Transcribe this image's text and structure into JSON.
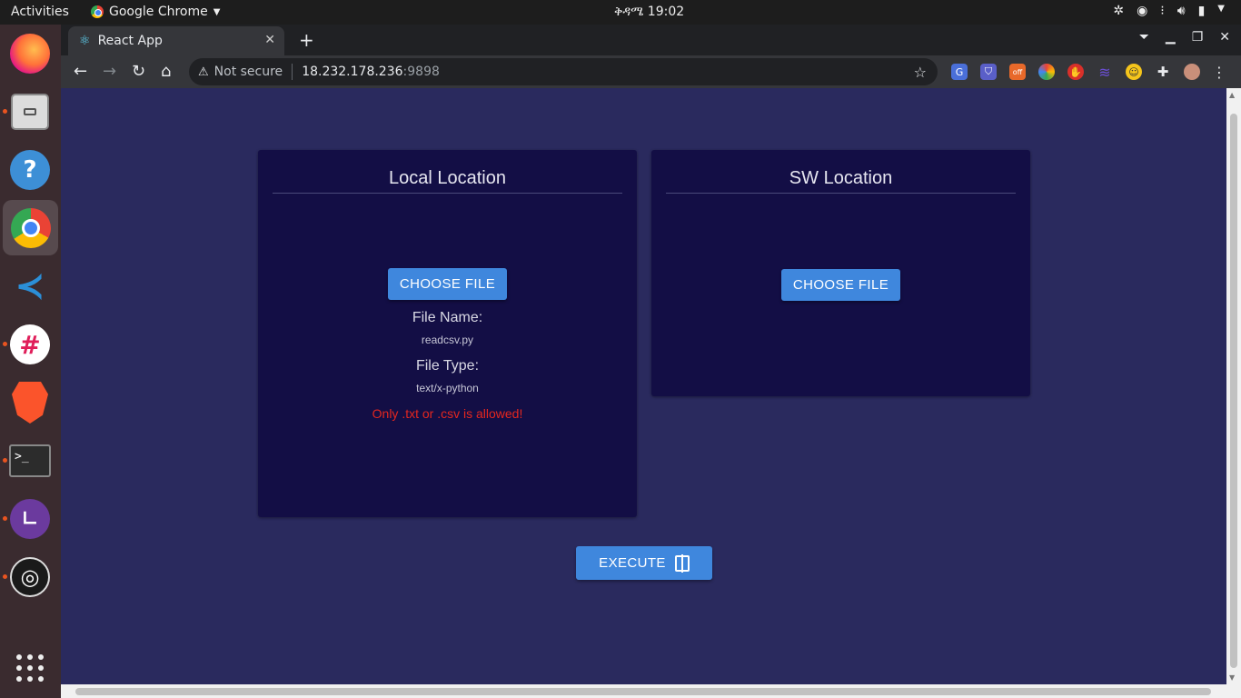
{
  "topbar": {
    "activities": "Activities",
    "app_name": "Google Chrome",
    "clock": "ቅዳሜ 19:02"
  },
  "dock": {
    "items": [
      {
        "name": "firefox"
      },
      {
        "name": "files"
      },
      {
        "name": "help"
      },
      {
        "name": "chrome"
      },
      {
        "name": "vscode"
      },
      {
        "name": "slack"
      },
      {
        "name": "brave"
      },
      {
        "name": "terminal"
      },
      {
        "name": "timer"
      },
      {
        "name": "obs"
      },
      {
        "name": "show-apps"
      }
    ]
  },
  "browser": {
    "tab_title": "React App",
    "security_label": "Not secure",
    "url_host": "18.232.178.236",
    "url_port": ":9898"
  },
  "local_card": {
    "title": "Local Location",
    "button_label": "CHOOSE FILE",
    "file_name_label": "File Name:",
    "file_name_value": "readcsv.py",
    "file_type_label": "File Type:",
    "file_type_value": "text/x-python",
    "error_message": "Only .txt or .csv is allowed!"
  },
  "sw_card": {
    "title": "SW Location",
    "button_label": "CHOOSE FILE"
  },
  "execute": {
    "label": "EXECUTE"
  },
  "colors": {
    "page_bg": "#2a2a5e",
    "card_bg": "#130e45",
    "button": "#3f87dd",
    "error": "#e5271f"
  }
}
